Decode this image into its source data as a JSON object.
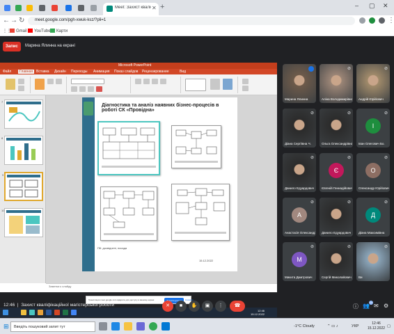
{
  "browser": {
    "active_tab_title": "Meet: Захист кваліфікаці",
    "new_tab_symbol": "+",
    "url": "meet.google.com/pgh-xwuk-ksz/?pli=1",
    "bookmarks": [
      {
        "label": "Gmail",
        "color": "#ea4335"
      },
      {
        "label": "YouTube",
        "color": "#ff0000"
      },
      {
        "label": "Карти",
        "color": "#34a853"
      }
    ]
  },
  "meet": {
    "recording_label": "Запис",
    "presenter_text": "Марина Ялинна на екрані",
    "time": "12:46",
    "meeting_title": "Захист кваліфікаційної магістерської роботи",
    "participants_count": "14"
  },
  "powerpoint": {
    "window_title": "Microsoft PowerPoint",
    "ribbon_tabs": [
      "Файл",
      "Главная",
      "Вставка",
      "Дизайн",
      "Переходы",
      "Анимация",
      "Показ слайдов",
      "Рецензирование",
      "Вид"
    ],
    "slide_numbers": [
      "7",
      "8",
      "9",
      "10"
    ],
    "slide": {
      "title": "Діагностика та аналіз наявних бізнес-процесів в роботі СК «Провідна»",
      "footer_left": "ПК: досвідчені, посада",
      "footer_right": "15.12.2022"
    },
    "notes_text": "Заметки к слайду"
  },
  "share_prompt": {
    "text": "Трансляция meet.google.com відкрита для доступу в вашому екрані",
    "stop_button": "Закрити доступ",
    "hide_button": "Сховати"
  },
  "inner_taskbar": {
    "time": "12:46",
    "date": "15.12.2022"
  },
  "participants": [
    {
      "name": "Марина Ялинна",
      "avatar": "",
      "color": "#6d5a4a",
      "photo": true,
      "speaking": true
    },
    {
      "name": "Аліна Володимирівна",
      "avatar": "",
      "color": "#9b8576",
      "photo": true
    },
    {
      "name": "Андрій Юрійович",
      "avatar": "",
      "color": "#a08a6a",
      "photo": true
    },
    {
      "name": "Діана Сергіївна Ч.",
      "avatar": "",
      "color": "#2b2b2b",
      "photo": true
    },
    {
      "name": "Ольга Олександрівна",
      "avatar": "",
      "color": "#2b2b2b",
      "photo": true
    },
    {
      "name": "Іван Олегович Бо.",
      "avatar": "І",
      "color": "#1e8e3e"
    },
    {
      "name": "Данило Едуардович",
      "avatar": "",
      "color": "#2b2b2b",
      "photo": true
    },
    {
      "name": "Євгеній Геннадійович",
      "avatar": "Є",
      "color": "#c2185b"
    },
    {
      "name": "Олександр Юрійович",
      "avatar": "О",
      "color": "#8d6e63"
    },
    {
      "name": "Анастасія Олександрівна",
      "avatar": "А",
      "color": "#a1887f"
    },
    {
      "name": "Данило Едуардович",
      "avatar": "",
      "color": "#2b2b2b",
      "photo": true
    },
    {
      "name": "Діана Максимівна",
      "avatar": "Д",
      "color": "#00897b"
    },
    {
      "name": "Микита Дмитрович",
      "avatar": "М",
      "color": "#7e57c2"
    },
    {
      "name": "Сергій Миколайович",
      "avatar": "",
      "color": "#2b2b2b",
      "photo": true
    },
    {
      "name": "Ви",
      "avatar": "",
      "color": "#8aa4b8",
      "photo": true
    }
  ],
  "controls": {
    "mic_icon": "mic-off-icon",
    "camera_icon": "camera-icon",
    "hand_icon": "raise-hand-icon",
    "present_icon": "present-icon",
    "more_icon": "more-icon",
    "end_icon": "end-call-icon"
  },
  "windows_taskbar": {
    "search_placeholder": "Введіть пошуковий запит тут",
    "weather": "-1°C  Cloudy",
    "lang": "УКР",
    "time": "12:46",
    "date": "15.12.2022"
  }
}
